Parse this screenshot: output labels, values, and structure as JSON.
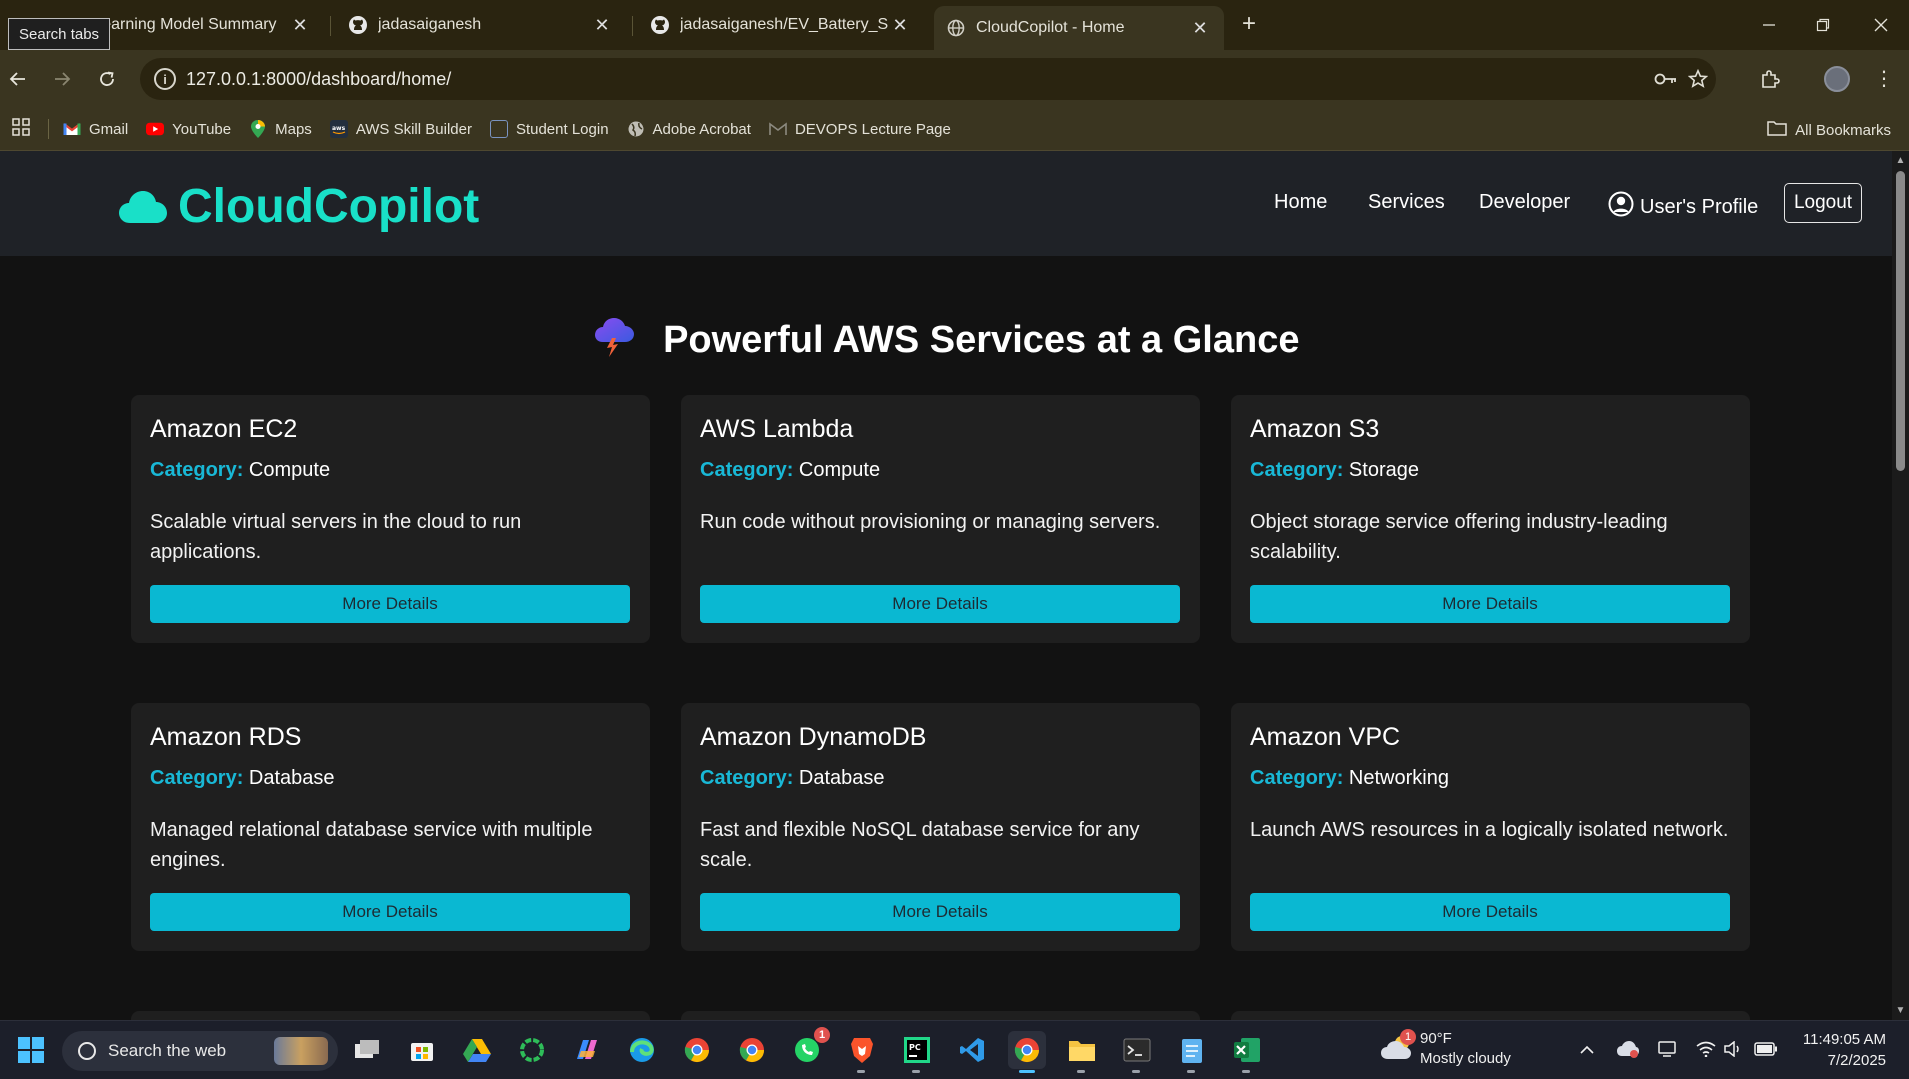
{
  "browser": {
    "tooltip": "Search tabs",
    "tabs": [
      {
        "label": "p Learning Model Summary",
        "close": "✕"
      },
      {
        "label": "jadasaiganesh",
        "close": "✕"
      },
      {
        "label": "jadasaiganesh/EV_Battery_SOH",
        "close": "✕"
      },
      {
        "label": "CloudCopilot - Home",
        "close": "✕",
        "active": true
      }
    ],
    "new_tab": "+",
    "url": "127.0.0.1:8000/dashboard/home/",
    "bookmarks": [
      {
        "label": "Gmail",
        "icon": "gmail-icon",
        "color": "#ea4335"
      },
      {
        "label": "YouTube",
        "icon": "youtube-icon",
        "color": "#ff0000"
      },
      {
        "label": "Maps",
        "icon": "maps-icon",
        "color": "#34a853"
      },
      {
        "label": "AWS Skill Builder",
        "icon": "aws-icon",
        "color": "#232f3e"
      },
      {
        "label": "Student Login",
        "icon": "student-login-icon",
        "color": "#4a6fa5"
      },
      {
        "label": "Adobe Acrobat",
        "icon": "globe-icon",
        "color": "#5f6368"
      },
      {
        "label": "DEVOPS Lecture Page",
        "icon": "gmail-icon",
        "color": "#5f6368"
      }
    ],
    "all_bookmarks": "All Bookmarks"
  },
  "site": {
    "brand": "CloudCopilot",
    "nav": {
      "home": "Home",
      "services": "Services",
      "developer": "Developer",
      "profile": "User's Profile",
      "logout": "Logout"
    },
    "heading": "Powerful AWS Services at a Glance",
    "category_label": "Category:",
    "button_label": "More Details",
    "services": [
      {
        "name": "Amazon EC2",
        "category": "Compute",
        "description": "Scalable virtual servers in the cloud to run applications."
      },
      {
        "name": "AWS Lambda",
        "category": "Compute",
        "description": "Run code without provisioning or managing servers."
      },
      {
        "name": "Amazon S3",
        "category": "Storage",
        "description": "Object storage service offering industry-leading scalability."
      },
      {
        "name": "Amazon RDS",
        "category": "Database",
        "description": "Managed relational database service with multiple engines."
      },
      {
        "name": "Amazon DynamoDB",
        "category": "Database",
        "description": "Fast and flexible NoSQL database service for any scale."
      },
      {
        "name": "Amazon VPC",
        "category": "Networking",
        "description": "Launch AWS resources in a logically isolated network."
      }
    ],
    "colors": {
      "brand": "#19e0c8",
      "accent": "#0ab8d2",
      "category": "#19b8d6"
    }
  },
  "taskbar": {
    "search_placeholder": "Search the web",
    "weather_temp": "90°F",
    "weather_desc": "Mostly cloudy",
    "weather_badge": "1",
    "whatsapp_badge": "1",
    "time": "11:49:05 AM",
    "date": "7/2/2025"
  }
}
